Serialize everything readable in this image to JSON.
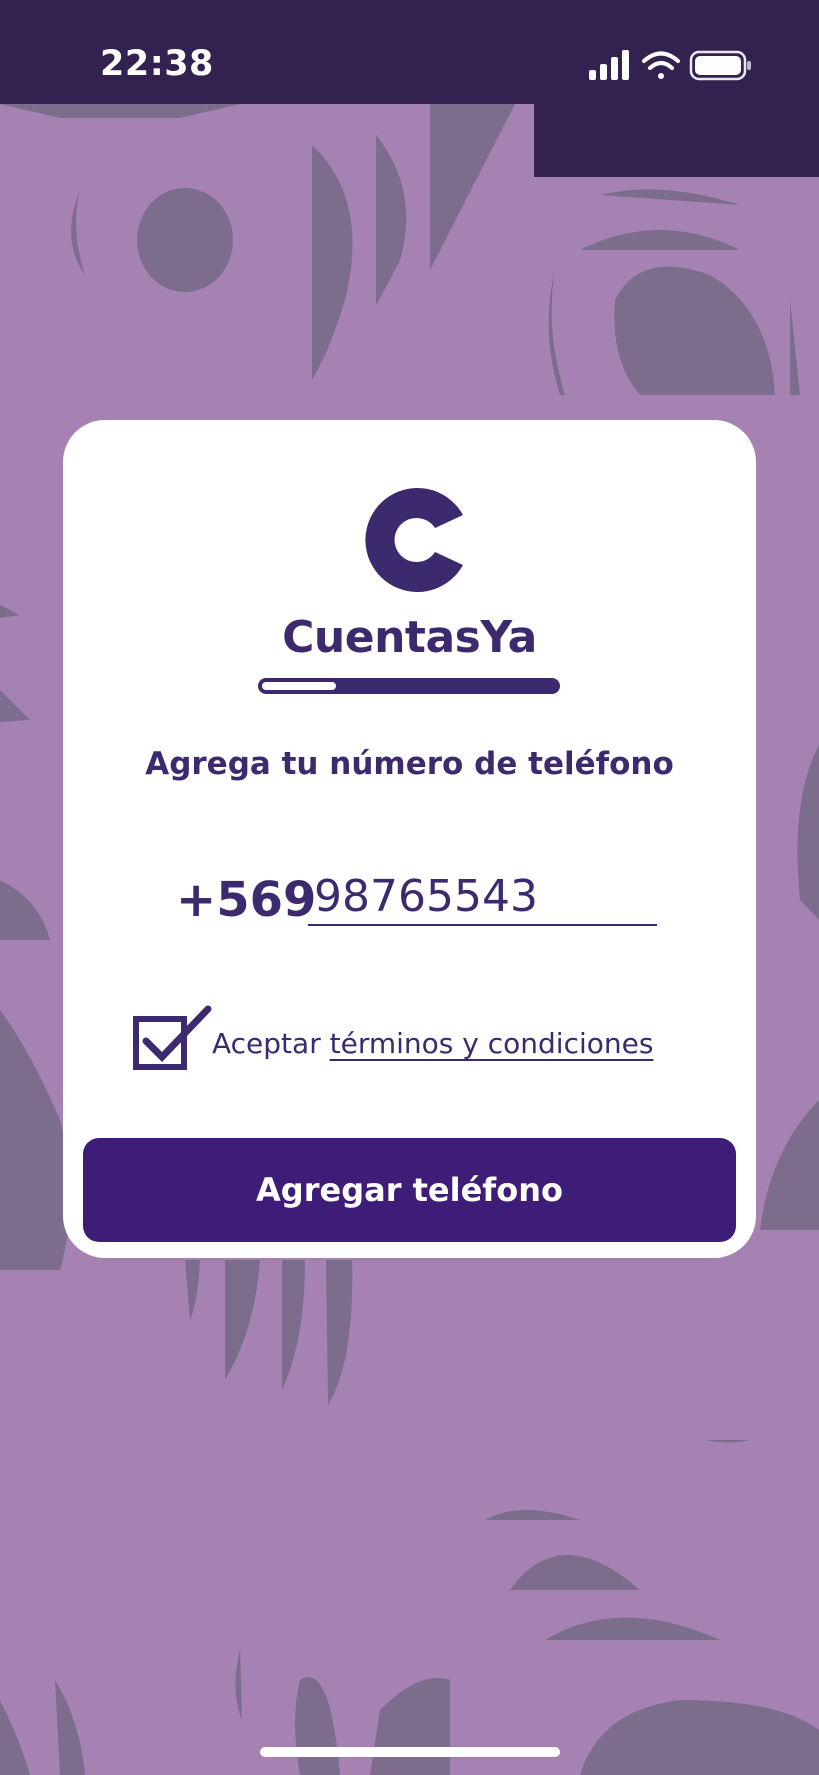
{
  "status_bar": {
    "time": "22:38",
    "icons": [
      "cellular-signal-icon",
      "wifi-icon",
      "battery-icon"
    ]
  },
  "brand": {
    "logo_icon": "cuentasya-c-logo-icon",
    "name": "CuentasYa"
  },
  "progress": {
    "fraction": 0.25
  },
  "form": {
    "heading": "Agrega tu número de teléfono",
    "country_code": "+569",
    "phone_value": "98765543",
    "terms_checked": true,
    "terms_prefix": "Aceptar",
    "terms_link": "términos y condiciones",
    "submit_label": "Agregar teléfono"
  },
  "colors": {
    "background": "#a682b3",
    "status_bar": "#33214f",
    "brand": "#3d2a6e",
    "button": "#3d1d77",
    "card": "#ffffff"
  }
}
